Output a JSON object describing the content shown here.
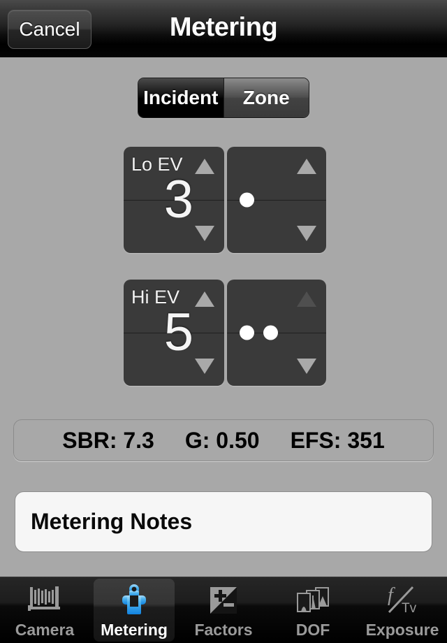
{
  "navbar": {
    "cancel_label": "Cancel",
    "title": "Metering"
  },
  "mode_selector": {
    "options": [
      "Incident",
      "Zone"
    ],
    "selected": "Incident",
    "incident_label": "Incident",
    "zone_label": "Zone"
  },
  "steppers": [
    {
      "label": "Lo EV",
      "value": "3",
      "fraction_dots": 1,
      "left_up_enabled": true,
      "left_down_enabled": true,
      "right_up_enabled": true,
      "right_down_enabled": true
    },
    {
      "label": "Hi EV",
      "value": "5",
      "fraction_dots": 2,
      "left_up_enabled": true,
      "left_down_enabled": true,
      "right_up_enabled": false,
      "right_down_enabled": true
    }
  ],
  "info_bar": {
    "sbr": "SBR: 7.3",
    "gamma": "G: 0.50",
    "efs": "EFS: 351"
  },
  "notes": {
    "value": "Metering Notes",
    "placeholder": "Metering Notes"
  },
  "tabbar": {
    "selected": "Metering",
    "items": [
      {
        "label": "Camera",
        "icon": "bellows-camera-icon"
      },
      {
        "label": "Metering",
        "icon": "light-meter-icon"
      },
      {
        "label": "Factors",
        "icon": "plus-minus-icon"
      },
      {
        "label": "DOF",
        "icon": "photo-stack-icon"
      },
      {
        "label": "Exposure",
        "icon": "f-over-tv-icon"
      }
    ]
  },
  "colors": {
    "background": "#a8a8a8",
    "panel": "#3a3a3a",
    "accent_blue": "#36a9f0",
    "arrow": "#a9a9a9",
    "arrow_disabled": "#4f4f4f"
  }
}
